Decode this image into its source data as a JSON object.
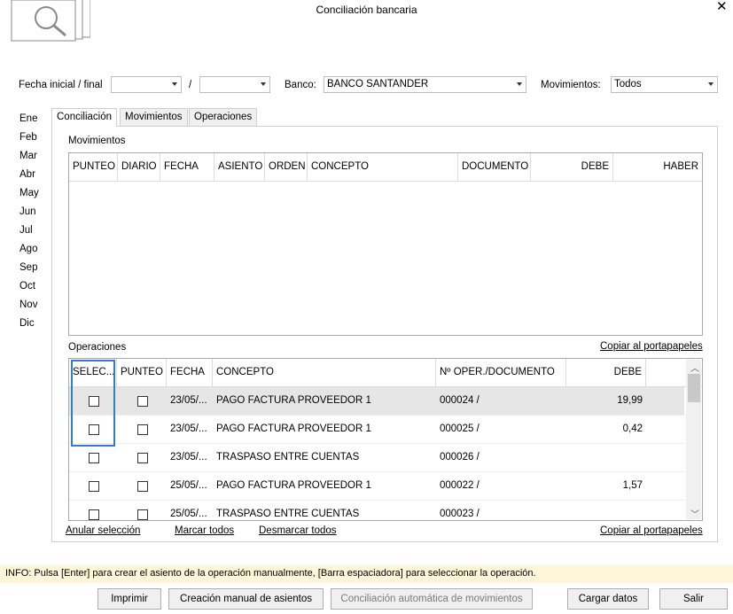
{
  "window": {
    "title": "Conciliación bancaria"
  },
  "filters": {
    "fecha_label": "Fecha inicial / final",
    "fecha_inicial": "",
    "separator": "/",
    "fecha_final": "",
    "banco_label": "Banco:",
    "banco_value": "BANCO SANTANDER",
    "movimientos_label": "Movimientos:",
    "movimientos_value": "Todos"
  },
  "months": [
    "Ene",
    "Feb",
    "Mar",
    "Abr",
    "May",
    "Jun",
    "Jul",
    "Ago",
    "Sep",
    "Oct",
    "Nov",
    "Dic"
  ],
  "tabs": [
    "Conciliación",
    "Movimientos",
    "Operaciones"
  ],
  "movimientos": {
    "title": "Movimientos",
    "columns": [
      "PUNTEO",
      "DIARIO",
      "FECHA",
      "ASIENTO",
      "ORDEN",
      "CONCEPTO",
      "DOCUMENTO",
      "DEBE",
      "HABER"
    ]
  },
  "operaciones": {
    "title": "Operaciones",
    "copy_link": "Copiar al portapapeles",
    "columns": [
      "SELEC...",
      "PUNTEO",
      "FECHA",
      "CONCEPTO",
      "Nº OPER./DOCUMENTO",
      "DEBE"
    ],
    "rows": [
      {
        "fecha": "23/05/...",
        "concepto": "PAGO FACTURA PROVEEDOR 1",
        "doc": "000024 /",
        "debe": "19,99"
      },
      {
        "fecha": "23/05/...",
        "concepto": "PAGO FACTURA PROVEEDOR 1",
        "doc": "000025 /",
        "debe": "0,42"
      },
      {
        "fecha": "23/05/...",
        "concepto": "TRASPASO ENTRE CUENTAS",
        "doc": "000026 /",
        "debe": ""
      },
      {
        "fecha": "25/05/...",
        "concepto": "PAGO FACTURA PROVEEDOR 1",
        "doc": "000022 /",
        "debe": "1,57"
      },
      {
        "fecha": "25/05/...",
        "concepto": "TRASPASO ENTRE CUENTAS",
        "doc": "000023 /",
        "debe": ""
      }
    ]
  },
  "bottom_links": {
    "anular": "Anular selección",
    "marcar": "Marcar todos",
    "desmarcar": "Desmarcar todos",
    "copiar": "Copiar al portapapeles"
  },
  "info": "INFO: Pulsa [Enter] para crear el asiento de la operación manualmente, [Barra espaciadora] para seleccionar la operación.",
  "buttons": {
    "imprimir": "Imprimir",
    "creacion": "Creación manual de asientos",
    "conciliacion": "Conciliación automática de movimientos",
    "cargar": "Cargar datos",
    "salir": "Salir"
  },
  "icons": {
    "logo": "documents-magnifier-icon",
    "close": "close-icon",
    "dropdown": "chevron-down-icon"
  }
}
